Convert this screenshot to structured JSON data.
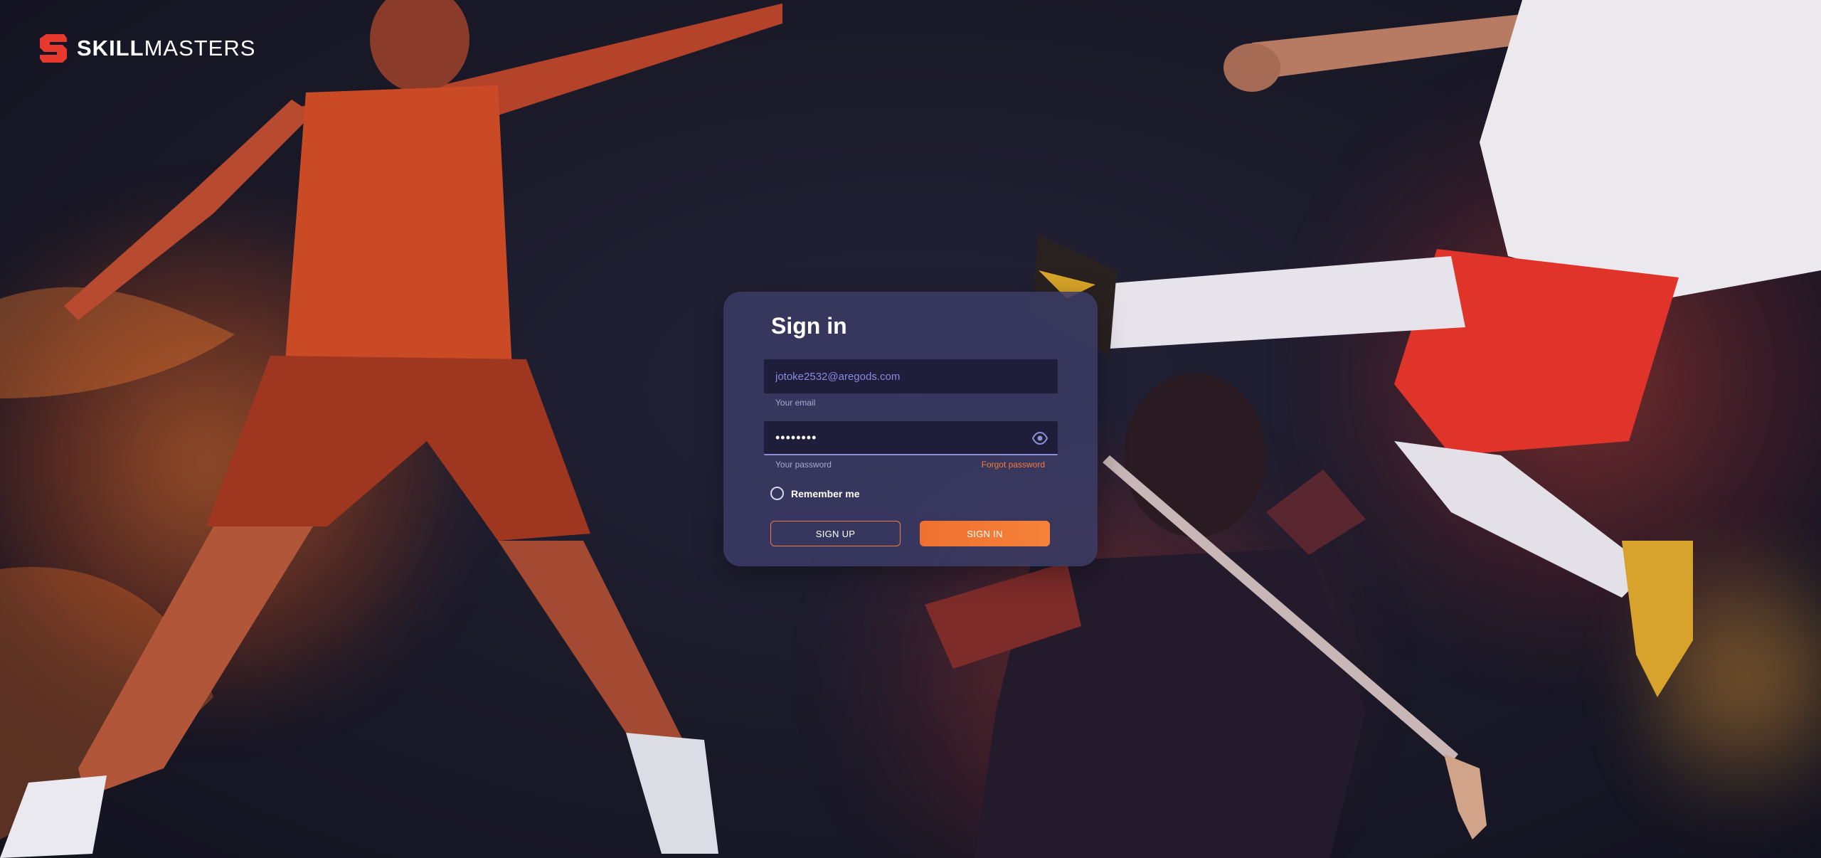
{
  "brand": {
    "name_bold": "SKILL",
    "name_regular": "MASTERS",
    "logo_icon": "skillmasters-s-logo-icon",
    "accent_color": "#f37b3c",
    "logo_color": "#e8392e"
  },
  "signin": {
    "title": "Sign in",
    "email": {
      "value": "jotoke2532@aregods.com",
      "helper": "Your email"
    },
    "password": {
      "value": "••••••••",
      "helper": "Your password",
      "toggle_icon": "eye-icon"
    },
    "forgot_label": "Forgot password",
    "remember_label": "Remember me",
    "remember_checked": false,
    "signup_label": "SIGN UP",
    "signin_label": "SIGN IN"
  },
  "colors": {
    "background": "#1b1a2c",
    "card": "#3a3a64",
    "field": "#1e1d3a",
    "primary": "#f0702f"
  }
}
